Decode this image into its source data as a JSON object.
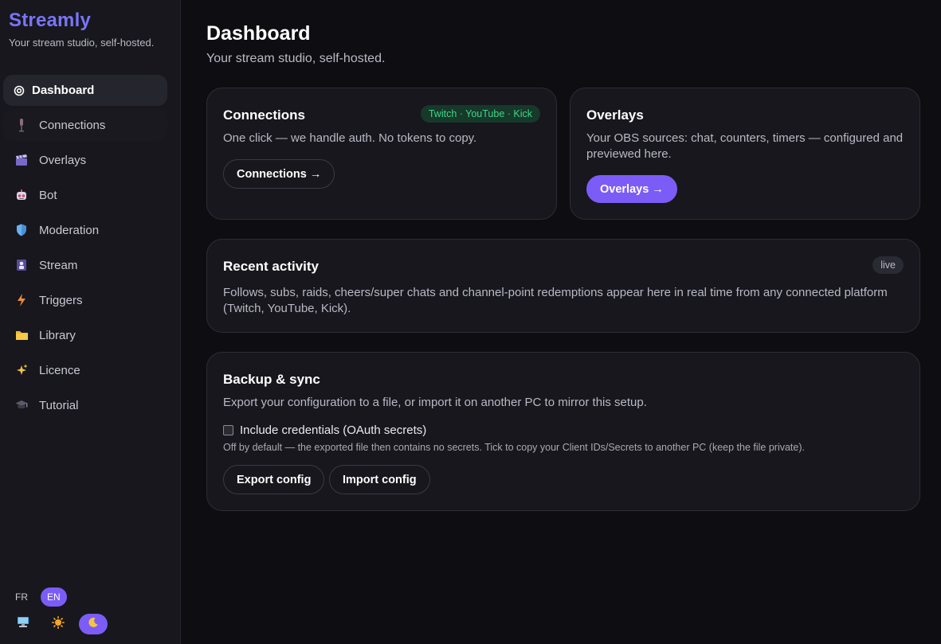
{
  "sidebar": {
    "brand": "Streamly",
    "tagline": "Your stream studio, self-hosted.",
    "items": [
      {
        "label": "Dashboard",
        "icon": "dashboard-icon",
        "active": true
      },
      {
        "label": "Connections",
        "icon": "microphone-icon"
      },
      {
        "label": "Overlays",
        "icon": "clapperboard-icon"
      },
      {
        "label": "Bot",
        "icon": "robot-icon"
      },
      {
        "label": "Moderation",
        "icon": "shield-icon"
      },
      {
        "label": "Stream",
        "icon": "broadcast-icon"
      },
      {
        "label": "Triggers",
        "icon": "lightning-icon"
      },
      {
        "label": "Library",
        "icon": "folder-icon"
      },
      {
        "label": "Licence",
        "icon": "sparkles-icon"
      },
      {
        "label": "Tutorial",
        "icon": "graduation-cap-icon"
      }
    ],
    "languages": [
      "FR",
      "EN"
    ],
    "active_language": "EN",
    "themes": [
      "monitor-icon",
      "sun-icon",
      "moon-icon"
    ],
    "active_theme": "moon-icon"
  },
  "main": {
    "title": "Dashboard",
    "subtitle": "Your stream studio, self-hosted.",
    "connections": {
      "title": "Connections",
      "badge": "Twitch · YouTube · Kick",
      "text": "One click — we handle auth. No tokens to copy.",
      "button": "Connections →"
    },
    "overlays": {
      "title": "Overlays",
      "text": "Your OBS sources: chat, counters, timers — configured and previewed here.",
      "button": "Overlays →"
    },
    "activity": {
      "title": "Recent activity",
      "badge": "live",
      "text": "Follows, subs, raids, cheers/super chats and channel-point redemptions appear here in real time from any connected platform (Twitch, YouTube, Kick)."
    },
    "backup": {
      "title": "Backup & sync",
      "text": "Export your configuration to a file, or import it on another PC to mirror this setup.",
      "checkbox_label": "Include credentials (OAuth secrets)",
      "checkbox_checked": false,
      "hint": "Off by default — the exported file then contains no secrets. Tick to copy your Client IDs/Secrets to another PC (keep the file private).",
      "export_button": "Export config",
      "import_button": "Import config"
    }
  },
  "colors": {
    "accent": "#7c5cf6",
    "brand": "#7a74f7",
    "badge_green": "#3fd58a",
    "background": "#0e0e12",
    "card": "#17171d"
  }
}
